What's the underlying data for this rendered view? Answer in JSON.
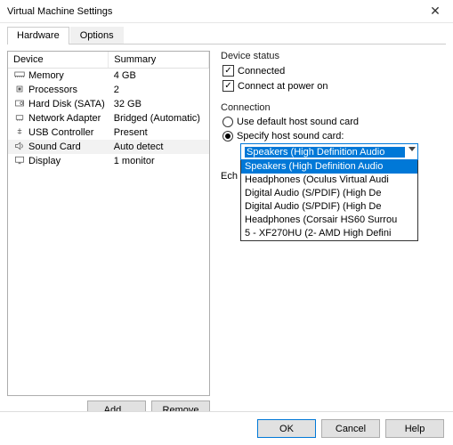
{
  "window": {
    "title": "Virtual Machine Settings",
    "close": "✕"
  },
  "tabs": {
    "hardware": "Hardware",
    "options": "Options"
  },
  "device_table": {
    "headers": {
      "device": "Device",
      "summary": "Summary"
    },
    "rows": [
      {
        "name": "Memory",
        "summary": "4 GB",
        "icon": "memory"
      },
      {
        "name": "Processors",
        "summary": "2",
        "icon": "cpu"
      },
      {
        "name": "Hard Disk (SATA)",
        "summary": "32 GB",
        "icon": "disk"
      },
      {
        "name": "Network Adapter",
        "summary": "Bridged (Automatic)",
        "icon": "nic"
      },
      {
        "name": "USB Controller",
        "summary": "Present",
        "icon": "usb"
      },
      {
        "name": "Sound Card",
        "summary": "Auto detect",
        "icon": "sound",
        "selected": true
      },
      {
        "name": "Display",
        "summary": "1 monitor",
        "icon": "display"
      }
    ]
  },
  "left_buttons": {
    "add": "Add...",
    "remove": "Remove"
  },
  "device_status": {
    "title": "Device status",
    "connected": "Connected",
    "connect_poweron": "Connect at power on"
  },
  "connection": {
    "title": "Connection",
    "default": "Use default host sound card",
    "specify": "Specify host sound card:",
    "selected": "Speakers (High Definition Audio",
    "options": [
      "Speakers (High Definition Audio",
      "Headphones (Oculus Virtual Audi",
      "Digital Audio (S/PDIF) (High De",
      "Digital Audio (S/PDIF) (High De",
      "Headphones (Corsair HS60 Surrou",
      "5 - XF270HU (2- AMD High Defini"
    ]
  },
  "echo": {
    "label": "Ech",
    "partial_chk_label": ""
  },
  "footer": {
    "ok": "OK",
    "cancel": "Cancel",
    "help": "Help"
  }
}
